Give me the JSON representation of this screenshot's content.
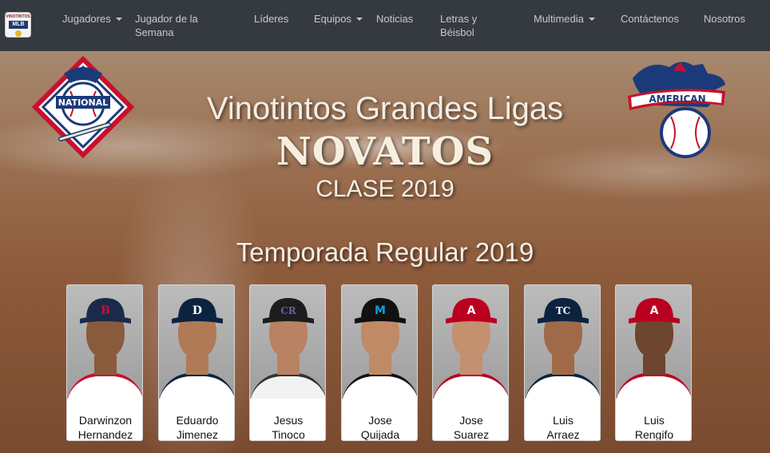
{
  "nav": {
    "brand": {
      "top": "VINOTINTOS",
      "mid": "MLB"
    },
    "items": [
      {
        "label": "Jugadores",
        "dropdown": true
      },
      {
        "label": "Jugador de la Semana",
        "dropdown": false
      },
      {
        "label": "Líderes",
        "dropdown": false
      },
      {
        "label": "Equipos",
        "dropdown": true
      },
      {
        "label": "Noticias",
        "dropdown": false
      },
      {
        "label": "Letras y Béisbol",
        "dropdown": false
      },
      {
        "label": "Multimedia",
        "dropdown": true
      },
      {
        "label": "Contáctenos",
        "dropdown": false
      },
      {
        "label": "Nosotros",
        "dropdown": false
      }
    ]
  },
  "hero": {
    "line1": "Vinotintos Grandes Ligas",
    "line2": "NOVATOS",
    "line3": "CLASE 2019",
    "season": "Temporada Regular 2019",
    "nl_logo_text": "NATIONAL",
    "al_logo_text": "AMERICAN"
  },
  "players": [
    {
      "first": "Darwinzon",
      "last": "Hernandez",
      "team_letter": "B",
      "cap": "#1b2a4a",
      "logo": "#c8102e",
      "skin": "#8a5a3c",
      "shirt": "#ffffff",
      "trim": "#c8102e"
    },
    {
      "first": "Eduardo",
      "last": "Jimenez",
      "team_letter": "D",
      "cap": "#0c2340",
      "logo": "#ffffff",
      "skin": "#b07a56",
      "shirt": "#ffffff",
      "trim": "#0c2340"
    },
    {
      "first": "Jesus",
      "last": "Tinoco",
      "team_letter": "CR",
      "cap": "#1d1d1d",
      "logo": "#6b5fa6",
      "skin": "#b98262",
      "shirt": "#f2f2f2",
      "trim": "#333333"
    },
    {
      "first": "Jose",
      "last": "Quijada",
      "team_letter": "M",
      "cap": "#111111",
      "logo": "#00a3e0",
      "skin": "#c08a66",
      "shirt": "#ffffff",
      "trim": "#111111"
    },
    {
      "first": "Jose",
      "last": "Suarez",
      "team_letter": "A",
      "cap": "#ba0021",
      "logo": "#ffffff",
      "skin": "#c39070",
      "shirt": "#ffffff",
      "trim": "#ba0021"
    },
    {
      "first": "Luis",
      "last": "Arraez",
      "team_letter": "TC",
      "cap": "#0c2340",
      "logo": "#ffffff",
      "skin": "#a06a48",
      "shirt": "#ffffff",
      "trim": "#0c2340"
    },
    {
      "first": "Luis",
      "last": "Rengifo",
      "team_letter": "A",
      "cap": "#ba0021",
      "logo": "#ffffff",
      "skin": "#6e452e",
      "shirt": "#ffffff",
      "trim": "#ba0021"
    }
  ]
}
